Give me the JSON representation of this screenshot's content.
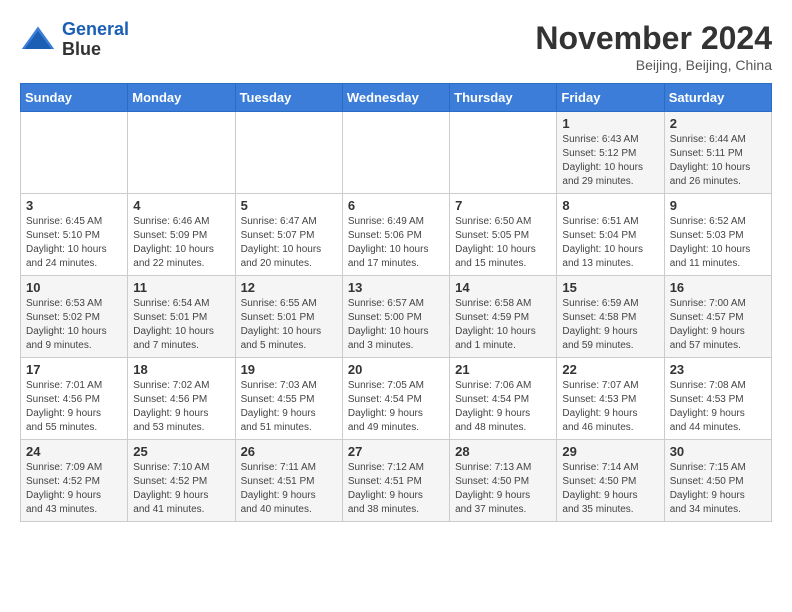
{
  "header": {
    "logo_line1": "General",
    "logo_line2": "Blue",
    "month": "November 2024",
    "location": "Beijing, Beijing, China"
  },
  "weekdays": [
    "Sunday",
    "Monday",
    "Tuesday",
    "Wednesday",
    "Thursday",
    "Friday",
    "Saturday"
  ],
  "weeks": [
    [
      {
        "day": "",
        "info": ""
      },
      {
        "day": "",
        "info": ""
      },
      {
        "day": "",
        "info": ""
      },
      {
        "day": "",
        "info": ""
      },
      {
        "day": "",
        "info": ""
      },
      {
        "day": "1",
        "info": "Sunrise: 6:43 AM\nSunset: 5:12 PM\nDaylight: 10 hours\nand 29 minutes."
      },
      {
        "day": "2",
        "info": "Sunrise: 6:44 AM\nSunset: 5:11 PM\nDaylight: 10 hours\nand 26 minutes."
      }
    ],
    [
      {
        "day": "3",
        "info": "Sunrise: 6:45 AM\nSunset: 5:10 PM\nDaylight: 10 hours\nand 24 minutes."
      },
      {
        "day": "4",
        "info": "Sunrise: 6:46 AM\nSunset: 5:09 PM\nDaylight: 10 hours\nand 22 minutes."
      },
      {
        "day": "5",
        "info": "Sunrise: 6:47 AM\nSunset: 5:07 PM\nDaylight: 10 hours\nand 20 minutes."
      },
      {
        "day": "6",
        "info": "Sunrise: 6:49 AM\nSunset: 5:06 PM\nDaylight: 10 hours\nand 17 minutes."
      },
      {
        "day": "7",
        "info": "Sunrise: 6:50 AM\nSunset: 5:05 PM\nDaylight: 10 hours\nand 15 minutes."
      },
      {
        "day": "8",
        "info": "Sunrise: 6:51 AM\nSunset: 5:04 PM\nDaylight: 10 hours\nand 13 minutes."
      },
      {
        "day": "9",
        "info": "Sunrise: 6:52 AM\nSunset: 5:03 PM\nDaylight: 10 hours\nand 11 minutes."
      }
    ],
    [
      {
        "day": "10",
        "info": "Sunrise: 6:53 AM\nSunset: 5:02 PM\nDaylight: 10 hours\nand 9 minutes."
      },
      {
        "day": "11",
        "info": "Sunrise: 6:54 AM\nSunset: 5:01 PM\nDaylight: 10 hours\nand 7 minutes."
      },
      {
        "day": "12",
        "info": "Sunrise: 6:55 AM\nSunset: 5:01 PM\nDaylight: 10 hours\nand 5 minutes."
      },
      {
        "day": "13",
        "info": "Sunrise: 6:57 AM\nSunset: 5:00 PM\nDaylight: 10 hours\nand 3 minutes."
      },
      {
        "day": "14",
        "info": "Sunrise: 6:58 AM\nSunset: 4:59 PM\nDaylight: 10 hours\nand 1 minute."
      },
      {
        "day": "15",
        "info": "Sunrise: 6:59 AM\nSunset: 4:58 PM\nDaylight: 9 hours\nand 59 minutes."
      },
      {
        "day": "16",
        "info": "Sunrise: 7:00 AM\nSunset: 4:57 PM\nDaylight: 9 hours\nand 57 minutes."
      }
    ],
    [
      {
        "day": "17",
        "info": "Sunrise: 7:01 AM\nSunset: 4:56 PM\nDaylight: 9 hours\nand 55 minutes."
      },
      {
        "day": "18",
        "info": "Sunrise: 7:02 AM\nSunset: 4:56 PM\nDaylight: 9 hours\nand 53 minutes."
      },
      {
        "day": "19",
        "info": "Sunrise: 7:03 AM\nSunset: 4:55 PM\nDaylight: 9 hours\nand 51 minutes."
      },
      {
        "day": "20",
        "info": "Sunrise: 7:05 AM\nSunset: 4:54 PM\nDaylight: 9 hours\nand 49 minutes."
      },
      {
        "day": "21",
        "info": "Sunrise: 7:06 AM\nSunset: 4:54 PM\nDaylight: 9 hours\nand 48 minutes."
      },
      {
        "day": "22",
        "info": "Sunrise: 7:07 AM\nSunset: 4:53 PM\nDaylight: 9 hours\nand 46 minutes."
      },
      {
        "day": "23",
        "info": "Sunrise: 7:08 AM\nSunset: 4:53 PM\nDaylight: 9 hours\nand 44 minutes."
      }
    ],
    [
      {
        "day": "24",
        "info": "Sunrise: 7:09 AM\nSunset: 4:52 PM\nDaylight: 9 hours\nand 43 minutes."
      },
      {
        "day": "25",
        "info": "Sunrise: 7:10 AM\nSunset: 4:52 PM\nDaylight: 9 hours\nand 41 minutes."
      },
      {
        "day": "26",
        "info": "Sunrise: 7:11 AM\nSunset: 4:51 PM\nDaylight: 9 hours\nand 40 minutes."
      },
      {
        "day": "27",
        "info": "Sunrise: 7:12 AM\nSunset: 4:51 PM\nDaylight: 9 hours\nand 38 minutes."
      },
      {
        "day": "28",
        "info": "Sunrise: 7:13 AM\nSunset: 4:50 PM\nDaylight: 9 hours\nand 37 minutes."
      },
      {
        "day": "29",
        "info": "Sunrise: 7:14 AM\nSunset: 4:50 PM\nDaylight: 9 hours\nand 35 minutes."
      },
      {
        "day": "30",
        "info": "Sunrise: 7:15 AM\nSunset: 4:50 PM\nDaylight: 9 hours\nand 34 minutes."
      }
    ]
  ]
}
